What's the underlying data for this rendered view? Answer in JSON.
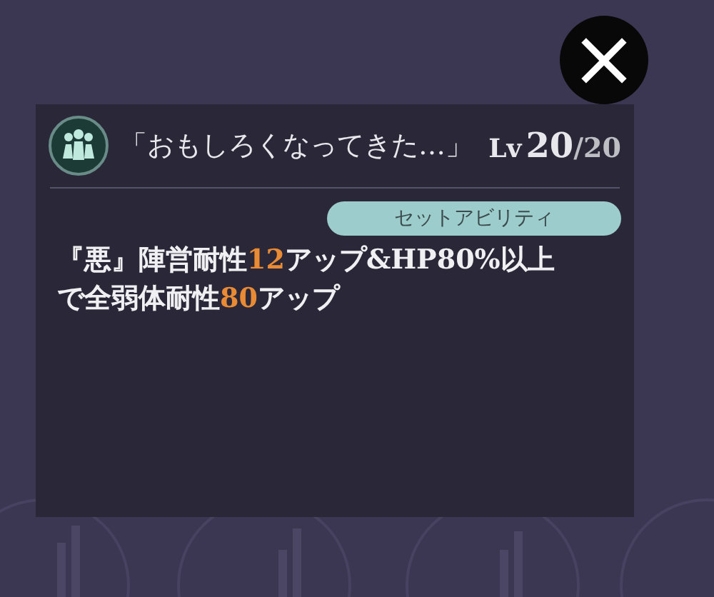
{
  "close_button": {
    "label": "×"
  },
  "ability": {
    "name": "「おもしろくなってきた…」",
    "level_prefix": "Lv",
    "level": "20",
    "level_max": "/20",
    "badge": "セットアビリティ",
    "description_lines": [
      [
        {
          "text": "『悪』陣営耐性",
          "highlight": false
        },
        {
          "text": "12",
          "highlight": true
        },
        {
          "text": "アップ&HP80%以上",
          "highlight": false
        }
      ],
      [
        {
          "text": "で全弱体耐性",
          "highlight": false
        },
        {
          "text": "80",
          "highlight": true
        },
        {
          "text": "アップ",
          "highlight": false
        }
      ]
    ]
  }
}
